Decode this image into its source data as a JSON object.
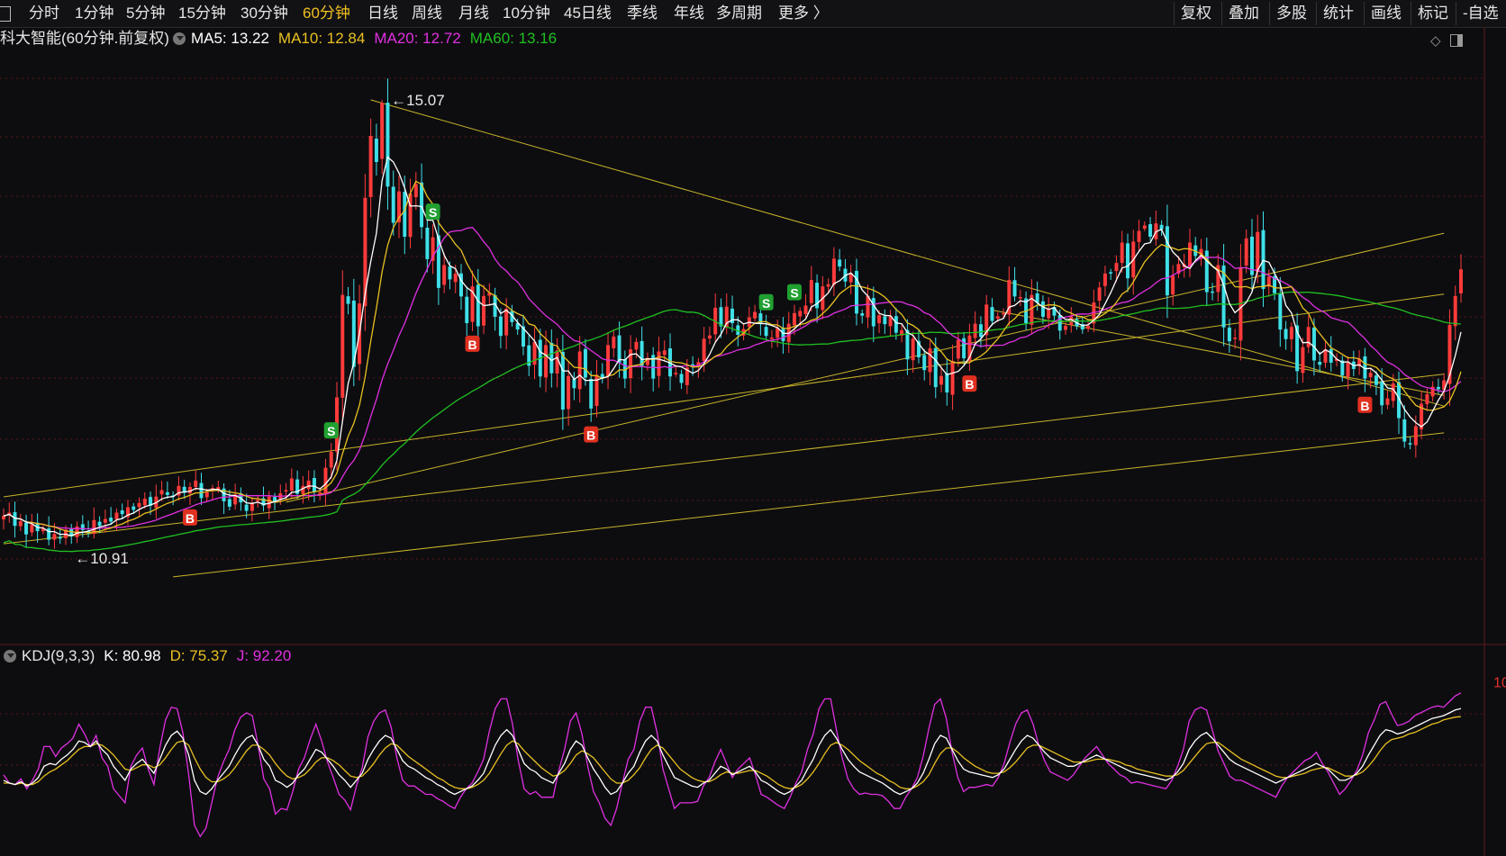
{
  "toolbar": {
    "periods": [
      "分时",
      "1分钟",
      "5分钟",
      "15分钟",
      "30分钟",
      "60分钟",
      "日线",
      "周线",
      "月线",
      "10分钟",
      "45日线",
      "季线",
      "年线",
      "多周期",
      "更多 〉"
    ],
    "active_period": "60分钟",
    "tools": [
      "复权",
      "叠加",
      "多股",
      "统计",
      "画线",
      "标记",
      "-自选"
    ]
  },
  "main_legend": {
    "title": "科大智能(60分钟.前复权)",
    "ma5": "MA5: 13.22",
    "ma10": "MA10: 12.84",
    "ma20": "MA20: 12.72",
    "ma60": "MA60: 13.16"
  },
  "kdj_legend": {
    "title": "KDJ(9,3,3)",
    "k": "K: 80.98",
    "d": "D: 75.37",
    "j": "J: 92.20"
  },
  "colors": {
    "up": "#ff3b3b",
    "down": "#3fe0e8",
    "ma5": "#ffffff",
    "ma10": "#e8c020",
    "ma20": "#e030e0",
    "ma60": "#20c020",
    "trendline": "#c8b428",
    "active_tab": "#f0c020",
    "buy_badge": "#e03020",
    "sell_badge": "#20a030",
    "axis_label": "#e03030"
  },
  "chart_data": {
    "type": "candlestick",
    "symbol": "科大智能",
    "period": "60分钟",
    "adjust": "前复权",
    "x": [
      0,
      1,
      2,
      3,
      4,
      5,
      6,
      7,
      8,
      9,
      10,
      11,
      12,
      13,
      14,
      15,
      16,
      17,
      18,
      19,
      20,
      21,
      22,
      23,
      24,
      25,
      26,
      27,
      28,
      29,
      30,
      31,
      32,
      33,
      34,
      35,
      36,
      37,
      38,
      39,
      40,
      41,
      42,
      43,
      44,
      45,
      46,
      47,
      48,
      49,
      50,
      51,
      52,
      53,
      54,
      55,
      56,
      57,
      58,
      59,
      60,
      61,
      62,
      63,
      64,
      65,
      66,
      67,
      68,
      69,
      70,
      71,
      72,
      73,
      74,
      75,
      76,
      77,
      78,
      79,
      80,
      81,
      82,
      83,
      84,
      85,
      86,
      87,
      88,
      89,
      90,
      91,
      92,
      93,
      94,
      95,
      96,
      97,
      98,
      99,
      100,
      101,
      102,
      103,
      104,
      105,
      106,
      107,
      108,
      109,
      110,
      111,
      112,
      113,
      114,
      115,
      116,
      117,
      118,
      119,
      120,
      121,
      122,
      123,
      124,
      125,
      126,
      127,
      128,
      129,
      130,
      131,
      132,
      133,
      134,
      135,
      136,
      137,
      138,
      139,
      140,
      141,
      142,
      143,
      144,
      145,
      146,
      147,
      148,
      149,
      150,
      151,
      152,
      153,
      154,
      155,
      156,
      157,
      158,
      159,
      160,
      161,
      162,
      163,
      164,
      165,
      166,
      167,
      168,
      169,
      170,
      171,
      172,
      173,
      174,
      175,
      176,
      177,
      178,
      179,
      180,
      181,
      182,
      183,
      184,
      185,
      186,
      187,
      188,
      189,
      190,
      191,
      192,
      193,
      194,
      195,
      196,
      197,
      198,
      199,
      200,
      201,
      202,
      203,
      204,
      205,
      206,
      207,
      208,
      209,
      210,
      211,
      212,
      213,
      214,
      215,
      216,
      217,
      218,
      219,
      220,
      221,
      222,
      223,
      224,
      225,
      226,
      227,
      228,
      229,
      230,
      231,
      232,
      233,
      234,
      235,
      236,
      237,
      238,
      239,
      240,
      241,
      242,
      243,
      244,
      245,
      246,
      247,
      248,
      249,
      250,
      251,
      252,
      253,
      254,
      255
    ],
    "close": [
      11.17,
      11.2,
      11.08,
      11.12,
      11.0,
      11.09,
      11.03,
      11.05,
      10.95,
      11.0,
      10.96,
      11.04,
      10.98,
      11.07,
      11.04,
      11.01,
      11.13,
      11.08,
      11.14,
      11.12,
      11.2,
      11.19,
      11.25,
      11.23,
      11.29,
      11.33,
      11.27,
      11.35,
      11.41,
      11.37,
      11.36,
      11.45,
      11.39,
      11.44,
      11.5,
      11.34,
      11.39,
      11.43,
      11.44,
      11.31,
      11.26,
      11.37,
      11.3,
      11.22,
      11.29,
      11.32,
      11.27,
      11.35,
      11.3,
      11.38,
      11.41,
      11.52,
      11.38,
      11.45,
      11.5,
      11.4,
      11.39,
      11.62,
      11.77,
      12.28,
      13.24,
      13.16,
      12.57,
      13.16,
      14.15,
      14.73,
      14.49,
      15.04,
      14.26,
      13.92,
      14.21,
      13.79,
      14.19,
      14.28,
      13.88,
      13.58,
      13.78,
      13.31,
      13.52,
      13.39,
      13.44,
      13.23,
      12.98,
      13.32,
      12.95,
      13.23,
      13.26,
      13.04,
      12.86,
      13.11,
      12.99,
      12.92,
      12.76,
      12.58,
      12.8,
      12.48,
      12.77,
      12.51,
      12.72,
      12.17,
      12.48,
      12.37,
      12.71,
      12.47,
      12.18,
      12.49,
      12.47,
      12.77,
      12.85,
      12.61,
      12.46,
      12.73,
      12.8,
      12.58,
      12.65,
      12.46,
      12.71,
      12.72,
      12.48,
      12.51,
      12.42,
      12.56,
      12.57,
      12.61,
      12.83,
      12.86,
      13.12,
      12.95,
      13.13,
      12.98,
      12.87,
      12.92,
      13.03,
      13.08,
      12.97,
      12.86,
      12.84,
      12.93,
      12.81,
      12.97,
      13.07,
      13.09,
      13.14,
      13.38,
      13.12,
      13.32,
      13.34,
      13.58,
      13.51,
      13.37,
      13.44,
      13.07,
      13.05,
      13.23,
      12.95,
      13.05,
      12.97,
      13.04,
      12.89,
      12.91,
      12.64,
      12.83,
      12.66,
      12.54,
      12.74,
      12.38,
      12.48,
      12.33,
      12.62,
      12.82,
      12.65,
      12.86,
      12.97,
      12.85,
      13.15,
      13.0,
      13.04,
      13.07,
      13.38,
      13.23,
      13.22,
      12.98,
      13.24,
      13.17,
      13.04,
      13.11,
      13.05,
      12.91,
      12.95,
      13.04,
      12.95,
      12.92,
      12.95,
      13.17,
      13.31,
      13.44,
      13.45,
      13.54,
      13.73,
      13.4,
      13.74,
      13.84,
      13.89,
      13.79,
      13.91,
      13.86,
      13.24,
      13.42,
      13.53,
      13.53,
      13.73,
      13.61,
      13.67,
      13.27,
      13.27,
      13.52,
      12.94,
      12.81,
      12.84,
      13.5,
      13.77,
      13.43,
      13.83,
      13.3,
      13.41,
      13.26,
      12.92,
      12.83,
      12.94,
      12.53,
      12.75,
      12.94,
      12.63,
      12.59,
      12.73,
      12.61,
      12.64,
      12.49,
      12.61,
      12.55,
      12.64,
      12.46,
      12.51,
      12.4,
      12.21,
      12.27,
      12.41,
      12.09,
      11.87,
      11.85,
      12.01,
      12.22,
      12.31,
      12.38,
      12.36,
      12.44,
      12.96,
      13.23,
      13.48
    ],
    "kdj": {
      "k": [
        30,
        28,
        27,
        29,
        26,
        28,
        32,
        40,
        42,
        41,
        45,
        48,
        52,
        58,
        57,
        54,
        58,
        52,
        48,
        40,
        35,
        30,
        38,
        42,
        45,
        40,
        35,
        45,
        55,
        62,
        65,
        60,
        48,
        30,
        22,
        20,
        24,
        30,
        35,
        40,
        48,
        55,
        60,
        62,
        55,
        45,
        40,
        30,
        28,
        25,
        28,
        34,
        38,
        45,
        52,
        50,
        45,
        40,
        34,
        30,
        25,
        30,
        35,
        45,
        52,
        58,
        62,
        60,
        52,
        44,
        40,
        38,
        35,
        32,
        30,
        27,
        25,
        22,
        20,
        22,
        24,
        26,
        30,
        35,
        45,
        55,
        62,
        66,
        62,
        52,
        42,
        38,
        36,
        32,
        30,
        28,
        35,
        42,
        52,
        58,
        55,
        46,
        38,
        32,
        25,
        20,
        22,
        28,
        35,
        40,
        50,
        58,
        62,
        58,
        48,
        40,
        32,
        30,
        28,
        26,
        25,
        28,
        30,
        35,
        40,
        38,
        34,
        36,
        38,
        40,
        36,
        30,
        28,
        25,
        22,
        20,
        22,
        26,
        30,
        38,
        45,
        55,
        62,
        66,
        60,
        52,
        45,
        40,
        36,
        34,
        32,
        30,
        28,
        25,
        22,
        20,
        22,
        24,
        28,
        35,
        45,
        56,
        62,
        60,
        52,
        44,
        38,
        36,
        35,
        34,
        33,
        32,
        34,
        38,
        45,
        52,
        58,
        62,
        60,
        55,
        50,
        46,
        44,
        42,
        40,
        40,
        42,
        44,
        46,
        48,
        46,
        44,
        42,
        40,
        38,
        36,
        35,
        34,
        33,
        32,
        31,
        30,
        32,
        36,
        42,
        52,
        58,
        62,
        64,
        60,
        55,
        50,
        45,
        42,
        40,
        38,
        36,
        34,
        32,
        30,
        28,
        30,
        32,
        34,
        36,
        38,
        40,
        42,
        40,
        38,
        34,
        30,
        30,
        32,
        35,
        40,
        48,
        55,
        62,
        66,
        65,
        63,
        64,
        66,
        68,
        70,
        72,
        74,
        75,
        76,
        78,
        80,
        80.98
      ],
      "d": [
        28,
        28,
        27,
        28,
        27,
        27,
        29,
        33,
        36,
        38,
        41,
        44,
        48,
        52,
        54,
        54,
        56,
        55,
        52,
        48,
        43,
        38,
        37,
        39,
        41,
        41,
        39,
        41,
        46,
        52,
        57,
        58,
        55,
        46,
        38,
        32,
        29,
        29,
        31,
        34,
        39,
        45,
        51,
        55,
        55,
        52,
        48,
        42,
        37,
        33,
        31,
        32,
        34,
        38,
        43,
        46,
        46,
        44,
        41,
        37,
        33,
        32,
        33,
        37,
        42,
        48,
        53,
        56,
        55,
        51,
        47,
        44,
        41,
        38,
        35,
        32,
        30,
        27,
        25,
        24,
        24,
        25,
        27,
        30,
        35,
        42,
        49,
        55,
        58,
        56,
        51,
        47,
        43,
        39,
        36,
        33,
        34,
        37,
        42,
        48,
        51,
        49,
        46,
        41,
        36,
        31,
        28,
        28,
        30,
        34,
        39,
        46,
        52,
        55,
        53,
        48,
        43,
        38,
        35,
        32,
        30,
        29,
        29,
        31,
        34,
        36,
        35,
        35,
        36,
        37,
        37,
        35,
        33,
        30,
        27,
        25,
        24,
        25,
        27,
        31,
        36,
        42,
        49,
        55,
        57,
        55,
        52,
        48,
        44,
        41,
        38,
        35,
        33,
        30,
        28,
        25,
        24,
        24,
        26,
        29,
        34,
        42,
        49,
        53,
        53,
        50,
        46,
        43,
        40,
        38,
        36,
        35,
        35,
        36,
        39,
        43,
        48,
        53,
        55,
        55,
        53,
        51,
        49,
        47,
        45,
        43,
        43,
        43,
        44,
        45,
        45,
        45,
        44,
        43,
        41,
        40,
        38,
        37,
        36,
        35,
        34,
        33,
        33,
        34,
        37,
        42,
        47,
        52,
        56,
        57,
        57,
        54,
        51,
        48,
        45,
        43,
        41,
        39,
        37,
        35,
        33,
        32,
        32,
        33,
        34,
        35,
        37,
        38,
        39,
        39,
        37,
        35,
        33,
        33,
        34,
        36,
        40,
        45,
        51,
        56,
        59,
        60,
        61,
        63,
        64,
        66,
        68,
        70,
        71,
        73,
        74,
        75,
        75.37
      ],
      "j": [
        34,
        28,
        27,
        31,
        24,
        30,
        38,
        54,
        54,
        47,
        53,
        56,
        60,
        70,
        63,
        54,
        62,
        46,
        40,
        24,
        19,
        14,
        40,
        48,
        53,
        38,
        27,
        53,
        73,
        82,
        81,
        64,
        34,
        -2,
        -10,
        -4,
        14,
        32,
        43,
        52,
        66,
        75,
        78,
        76,
        55,
        31,
        24,
        6,
        10,
        9,
        22,
        38,
        46,
        59,
        70,
        58,
        43,
        32,
        20,
        16,
        9,
        26,
        39,
        61,
        72,
        78,
        80,
        68,
        46,
        30,
        26,
        26,
        23,
        20,
        20,
        17,
        15,
        12,
        10,
        18,
        24,
        28,
        36,
        45,
        65,
        81,
        88,
        88,
        70,
        44,
        24,
        20,
        22,
        18,
        18,
        18,
        37,
        52,
        72,
        78,
        63,
        40,
        22,
        14,
        3,
        -2,
        10,
        28,
        45,
        52,
        72,
        82,
        82,
        64,
        38,
        24,
        10,
        14,
        14,
        14,
        15,
        26,
        32,
        43,
        52,
        42,
        32,
        38,
        42,
        46,
        34,
        20,
        18,
        15,
        12,
        10,
        18,
        28,
        36,
        52,
        63,
        81,
        88,
        88,
        66,
        46,
        31,
        24,
        20,
        21,
        20,
        20,
        19,
        15,
        10,
        10,
        18,
        24,
        32,
        47,
        67,
        84,
        88,
        74,
        50,
        32,
        22,
        25,
        25,
        26,
        27,
        26,
        32,
        42,
        57,
        70,
        78,
        80,
        70,
        55,
        44,
        36,
        34,
        32,
        30,
        34,
        40,
        46,
        50,
        54,
        48,
        42,
        38,
        34,
        32,
        28,
        29,
        28,
        27,
        26,
        25,
        24,
        30,
        40,
        52,
        72,
        80,
        82,
        80,
        66,
        51,
        42,
        33,
        30,
        30,
        28,
        26,
        24,
        22,
        20,
        18,
        26,
        32,
        36,
        40,
        44,
        46,
        50,
        42,
        36,
        28,
        20,
        24,
        30,
        37,
        48,
        64,
        73,
        84,
        86,
        77,
        69,
        70,
        72,
        76,
        78,
        80,
        82,
        83,
        82,
        86,
        90,
        92.2
      ]
    },
    "annotations": {
      "high_label": "15.07",
      "low_label": "10.91",
      "buy_marker": "B",
      "sell_marker": "S",
      "kdj_axis_label": "10"
    },
    "buy_points": [
      33,
      83,
      104,
      171,
      241
    ],
    "sell_points": [
      58,
      76,
      135,
      140
    ]
  }
}
